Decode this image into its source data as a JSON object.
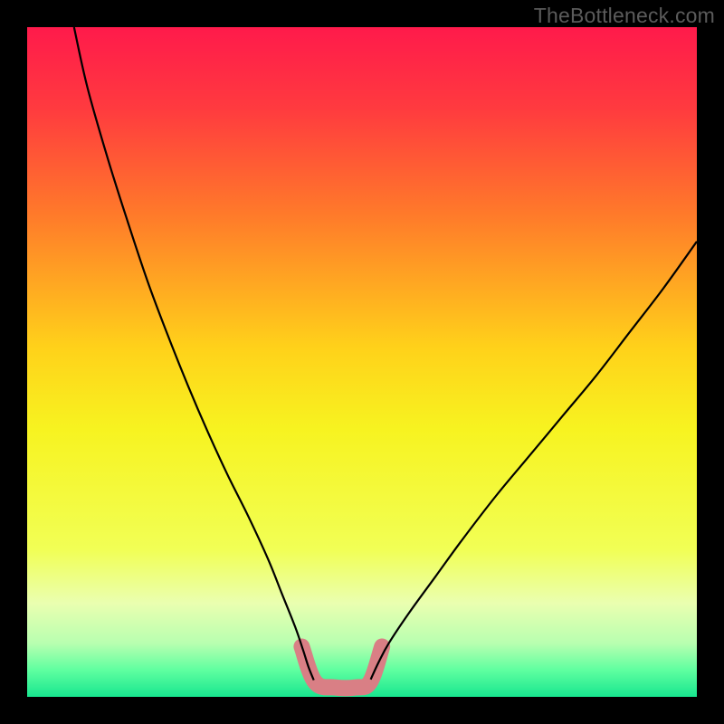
{
  "watermark": "TheBottleneck.com",
  "chart_data": {
    "type": "line",
    "title": "",
    "xlabel": "",
    "ylabel": "",
    "xlim": [
      0,
      100
    ],
    "ylim": [
      0,
      100
    ],
    "background_gradient_stops": [
      {
        "offset": 0.0,
        "color": "#ff1a4b"
      },
      {
        "offset": 0.12,
        "color": "#ff3a3f"
      },
      {
        "offset": 0.28,
        "color": "#ff7a2a"
      },
      {
        "offset": 0.48,
        "color": "#ffd21a"
      },
      {
        "offset": 0.6,
        "color": "#f7f320"
      },
      {
        "offset": 0.78,
        "color": "#f1ff55"
      },
      {
        "offset": 0.86,
        "color": "#eaffb0"
      },
      {
        "offset": 0.92,
        "color": "#b8ffb0"
      },
      {
        "offset": 0.96,
        "color": "#5fffa0"
      },
      {
        "offset": 1.0,
        "color": "#18e68f"
      }
    ],
    "series": [
      {
        "name": "curve-left",
        "stroke": "#000000",
        "stroke_width": 2.2,
        "points": [
          {
            "x": 7.0,
            "y": 100.0
          },
          {
            "x": 9.0,
            "y": 91.0
          },
          {
            "x": 12.0,
            "y": 80.5
          },
          {
            "x": 15.0,
            "y": 71.0
          },
          {
            "x": 18.0,
            "y": 62.0
          },
          {
            "x": 21.0,
            "y": 54.0
          },
          {
            "x": 24.0,
            "y": 46.5
          },
          {
            "x": 27.0,
            "y": 39.5
          },
          {
            "x": 30.0,
            "y": 33.0
          },
          {
            "x": 33.0,
            "y": 27.0
          },
          {
            "x": 36.0,
            "y": 20.5
          },
          {
            "x": 38.0,
            "y": 15.5
          },
          {
            "x": 40.0,
            "y": 10.5
          },
          {
            "x": 41.2,
            "y": 7.0
          },
          {
            "x": 42.0,
            "y": 4.5
          },
          {
            "x": 42.8,
            "y": 2.5
          }
        ]
      },
      {
        "name": "curve-right",
        "stroke": "#000000",
        "stroke_width": 2.2,
        "points": [
          {
            "x": 51.3,
            "y": 2.6
          },
          {
            "x": 52.5,
            "y": 5.2
          },
          {
            "x": 54.0,
            "y": 8.0
          },
          {
            "x": 57.0,
            "y": 12.5
          },
          {
            "x": 61.0,
            "y": 18.0
          },
          {
            "x": 65.0,
            "y": 23.5
          },
          {
            "x": 70.0,
            "y": 30.0
          },
          {
            "x": 75.0,
            "y": 36.0
          },
          {
            "x": 80.0,
            "y": 42.0
          },
          {
            "x": 85.0,
            "y": 48.0
          },
          {
            "x": 90.0,
            "y": 54.5
          },
          {
            "x": 95.0,
            "y": 61.0
          },
          {
            "x": 100.0,
            "y": 68.0
          }
        ]
      },
      {
        "name": "bottom-highlight",
        "stroke": "#d97f85",
        "stroke_width": 18,
        "linecap": "round",
        "linejoin": "round",
        "points": [
          {
            "x": 41.0,
            "y": 7.5
          },
          {
            "x": 43.0,
            "y": 2.2
          },
          {
            "x": 46.0,
            "y": 1.4
          },
          {
            "x": 49.0,
            "y": 1.4
          },
          {
            "x": 51.2,
            "y": 2.2
          },
          {
            "x": 53.0,
            "y": 7.5
          }
        ]
      }
    ]
  }
}
